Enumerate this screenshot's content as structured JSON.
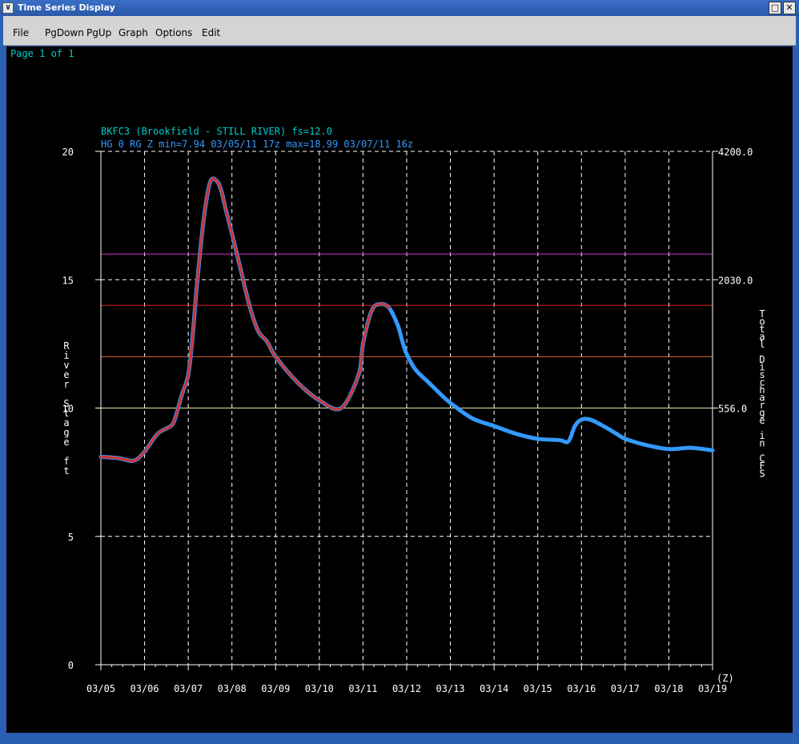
{
  "window": {
    "title": "Time Series Display",
    "minimize_glyph": "□",
    "close_glyph": "✕",
    "sys_glyph": "∨"
  },
  "menu": [
    "File",
    "PgDown",
    "PgUp",
    "Graph",
    "Options",
    "Edit"
  ],
  "page_info": "Page 1 of 1",
  "colors": {
    "line": "#3399ff",
    "observed_dots": "#cc3333",
    "grid": "#ffffff",
    "title_text": "#00cccc",
    "subtitle_text": "#3399ff",
    "flood_major": "#cc33cc",
    "flood_moderate": "#dd2222",
    "flood_minor": "#dd6633",
    "flood_action": "#e6e6a0"
  },
  "chart_data": {
    "type": "line",
    "title": "BKFC3 (Brookfield - STILL RIVER) fs=12.0",
    "subtitle": "HG 0 RG Z min=7.94 03/05/11 17z max=18.99 03/07/11 16z",
    "ylabel": "River Stage ft",
    "ylabel_right": "Total Discharge in CFS",
    "x_unit_label": "(Z)",
    "x_ticks": [
      "03/05",
      "03/06",
      "03/07",
      "03/08",
      "03/09",
      "03/10",
      "03/11",
      "03/12",
      "03/13",
      "03/14",
      "03/15",
      "03/16",
      "03/17",
      "03/18",
      "03/19"
    ],
    "y_ticks": [
      0,
      5,
      10,
      15,
      20
    ],
    "ylim": [
      0,
      20
    ],
    "right_ticks": [
      {
        "stage": 20,
        "label": "4200.0"
      },
      {
        "stage": 15,
        "label": "2030.0"
      },
      {
        "stage": 10,
        "label": "556.0"
      }
    ],
    "threshold_lines": [
      {
        "stage": 16,
        "color_key": "flood_major"
      },
      {
        "stage": 14,
        "color_key": "flood_moderate"
      },
      {
        "stage": 12,
        "color_key": "flood_minor"
      },
      {
        "stage": 10,
        "color_key": "flood_action"
      }
    ],
    "grid": true,
    "series": [
      {
        "days": [
          0,
          0.4,
          0.75,
          1.0,
          1.3,
          1.6,
          1.7,
          1.85,
          2.0,
          2.1,
          2.2,
          2.35,
          2.5,
          2.65,
          2.75,
          2.85,
          3.0,
          3.2,
          3.4,
          3.6,
          3.8,
          4.0,
          4.5,
          5.0,
          5.5,
          5.9,
          6.0,
          6.2,
          6.4,
          6.6,
          6.8,
          6.9,
          7.0,
          7.2,
          7.5,
          7.8,
          8.0,
          8.5,
          9.0,
          9.5,
          10.0,
          10.5,
          10.7,
          10.85,
          11.0,
          11.2,
          11.5,
          11.8,
          12.0,
          12.5,
          13.0,
          13.5,
          14.0
        ],
        "stage": [
          8.1,
          8.05,
          7.95,
          8.3,
          9.0,
          9.3,
          9.6,
          10.5,
          11.3,
          12.8,
          14.8,
          17.3,
          18.8,
          18.85,
          18.5,
          17.8,
          16.8,
          15.4,
          14.0,
          13.0,
          12.6,
          12.0,
          11.0,
          10.3,
          10.0,
          11.3,
          12.5,
          13.8,
          14.05,
          13.9,
          13.2,
          12.6,
          12.1,
          11.5,
          11.0,
          10.5,
          10.2,
          9.6,
          9.3,
          9.0,
          8.8,
          8.75,
          8.7,
          9.3,
          9.55,
          9.55,
          9.3,
          9.0,
          8.8,
          8.55,
          8.4,
          8.45,
          8.35
        ],
        "observed_until_day": 6.6
      }
    ]
  }
}
